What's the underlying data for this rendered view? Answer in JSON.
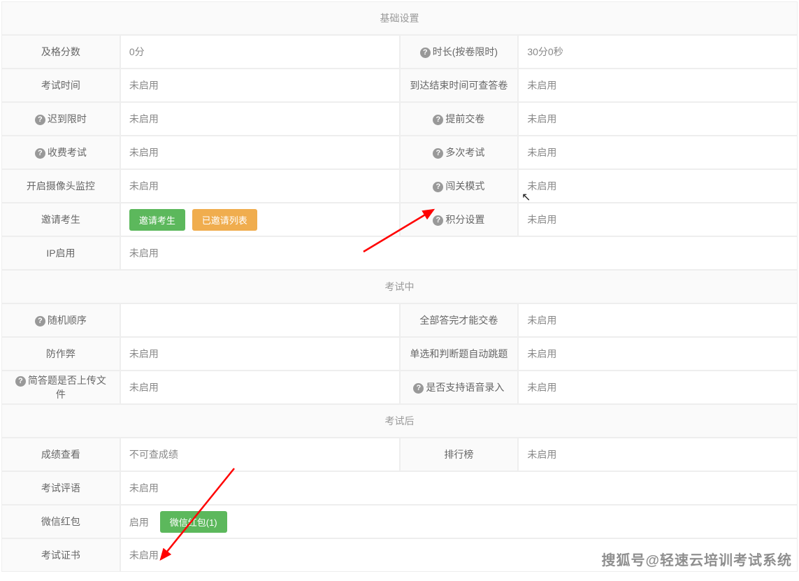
{
  "sections": {
    "basic": {
      "title": "基础设置",
      "rows": [
        {
          "l1": "及格分数",
          "v1": "0分",
          "l2": "时长(按卷限时)",
          "v2": "30分0秒",
          "help1": false,
          "help2": true
        },
        {
          "l1": "考试时间",
          "v1": "未启用",
          "l2": "到达结束时间可查答卷",
          "v2": "未启用",
          "help1": false,
          "help2": false
        },
        {
          "l1": "迟到限时",
          "v1": "未启用",
          "l2": "提前交卷",
          "v2": "未启用",
          "help1": true,
          "help2": true
        },
        {
          "l1": "收费考试",
          "v1": "未启用",
          "l2": "多次考试",
          "v2": "未启用",
          "help1": true,
          "help2": true
        },
        {
          "l1": "开启摄像头监控",
          "v1": "未启用",
          "l2": "闯关模式",
          "v2": "未启用",
          "help1": false,
          "help2": true
        },
        {
          "l1": "邀请考生",
          "v1_buttons": true,
          "l2": "积分设置",
          "v2": "未启用",
          "help1": false,
          "help2": true
        },
        {
          "l1": "IP启用",
          "v1": "未启用",
          "help1": false,
          "full": true
        }
      ],
      "invite_btn": "邀请考生",
      "invited_btn": "已邀请列表"
    },
    "during": {
      "title": "考试中",
      "rows": [
        {
          "l1": "随机顺序",
          "v1": "",
          "l2": "全部答完才能交卷",
          "v2": "未启用",
          "help1": true,
          "help2": false
        },
        {
          "l1": "防作弊",
          "v1": "未启用",
          "l2": "单选和判断题自动跳题",
          "v2": "未启用",
          "help1": false,
          "help2": false
        },
        {
          "l1": "简答题是否上传文件",
          "v1": "未启用",
          "l2": "是否支持语音录入",
          "v2": "未启用",
          "help1": true,
          "help2": true
        }
      ]
    },
    "after": {
      "title": "考试后",
      "rows": [
        {
          "l1": "成绩查看",
          "v1": "不可查成绩",
          "l2": "排行榜",
          "v2": "未启用",
          "help1": false,
          "help2": false
        },
        {
          "l1": "考试评语",
          "v1": "未启用",
          "help1": false,
          "full": true
        },
        {
          "l1": "微信红包",
          "v1_text": "启用",
          "v1_btn": "微信红包(1)",
          "help1": false,
          "full": true,
          "hongbao": true
        },
        {
          "l1": "考试证书",
          "v1": "未启用",
          "help1": false,
          "full": true
        }
      ]
    }
  },
  "watermark": "搜狐号@轻速云培训考试系统"
}
